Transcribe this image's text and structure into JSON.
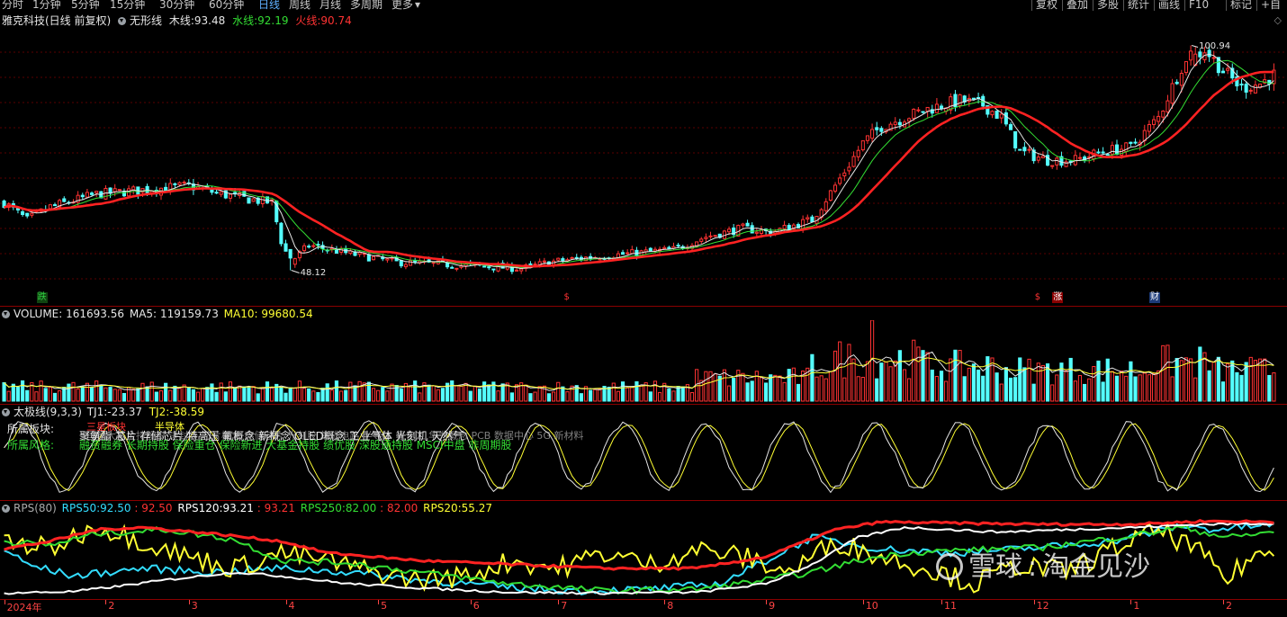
{
  "toolbar": {
    "periods": [
      "分时",
      "1分钟",
      "5分钟",
      "15分钟",
      "30分钟",
      "60分钟",
      "日线",
      "周线",
      "月线",
      "多周期",
      "更多"
    ],
    "active_period": "日线",
    "right_buttons": [
      "复权",
      "叠加",
      "多股",
      "统计",
      "画线",
      "F10",
      "标记",
      "+自"
    ]
  },
  "main_panel": {
    "title": "雅克科技(日线 前复权)",
    "indicator_name": "无形线",
    "mu_label": "木线:",
    "mu_value": "93.48",
    "shui_label": "水线:",
    "shui_value": "92.19",
    "huo_label": "火线:",
    "huo_value": "90.74",
    "high_label": "100.94",
    "low_label": "48.12",
    "markers": [
      {
        "text": "跌",
        "day": 8,
        "color": "#2ecc40",
        "bg": "#114411"
      },
      {
        "text": "$",
        "day": 122,
        "color": "#ff3333",
        "bg": ""
      },
      {
        "text": "$",
        "day": 224,
        "color": "#ff3333",
        "bg": ""
      },
      {
        "text": "涨",
        "day": 228,
        "color": "#ffffff",
        "bg": "#8a0000"
      },
      {
        "text": "财",
        "day": 249,
        "color": "#ffffff",
        "bg": "#1c3a78"
      }
    ]
  },
  "volume_panel": {
    "label": "VOLUME:",
    "value": "161693.56",
    "ma5_label": "MA5:",
    "ma5_value": "119159.73",
    "ma10_label": "MA10:",
    "ma10_value": "99680.54"
  },
  "taiji_panel": {
    "name": "太极线(9,3,3)",
    "tj1_label": "TJ1:",
    "tj1_value": "-23.37",
    "tj2_label": "TJ2:",
    "tj2_value": "-38.59",
    "sector_label": "所属板块:",
    "sector_tag1": "三星板块",
    "sector_tag2": "半导体",
    "concept_text": "国家大基金持股 先进封装 芯片概念 存储芯片 光刻胶 集成电路 半导体 氟化工 华为概念 PCB 数据中心 5G 新材料",
    "overlay_text": "聚氨酯 芯片 存储芯片 特高压 氟概念 新概念 OLED概念 工业气体 光刻机 天然气",
    "style_label": "所属风格:",
    "style_text": "融资融券 长期持股 保险重仓 保险新进 大基金持股 绩优股 深股通持股 MSCI中盘 非周期股"
  },
  "rps_panel": {
    "name": "RPS(80)",
    "rps50_label": "RPS50:",
    "rps50_value": "92.50",
    "rps50b_value": ": 92.50",
    "rps120_label": "RPS120:",
    "rps120_value": "93.21",
    "rps120b_value": ": 93.21",
    "rps250_label": "RPS250:",
    "rps250_value": "82.00",
    "rps250b_value": ": 82.00",
    "rps20_label": "RPS20:",
    "rps20_value": "55.27"
  },
  "x_axis": {
    "labels": [
      {
        "text": "2024年",
        "day": 0
      },
      {
        "text": "2",
        "day": 22
      },
      {
        "text": "3",
        "day": 40
      },
      {
        "text": "4",
        "day": 61
      },
      {
        "text": "5",
        "day": 81
      },
      {
        "text": "6",
        "day": 101
      },
      {
        "text": "7",
        "day": 120
      },
      {
        "text": "8",
        "day": 143
      },
      {
        "text": "9",
        "day": 165
      },
      {
        "text": "10",
        "day": 186
      },
      {
        "text": "11",
        "day": 203
      },
      {
        "text": "12",
        "day": 223
      },
      {
        "text": "1",
        "day": 244
      },
      {
        "text": "2",
        "day": 264
      }
    ]
  },
  "watermark": {
    "brand": "雪球",
    "separator": ":",
    "author": "淘金见沙"
  },
  "chart_data": {
    "type": "candlestick",
    "days": 276,
    "price_range": [
      44,
      104
    ],
    "anchors": [
      [
        0,
        64
      ],
      [
        5,
        60
      ],
      [
        10,
        63
      ],
      [
        20,
        66
      ],
      [
        30,
        67
      ],
      [
        40,
        68
      ],
      [
        47,
        66
      ],
      [
        52,
        65
      ],
      [
        58,
        64
      ],
      [
        60,
        55
      ],
      [
        62,
        50
      ],
      [
        66,
        54
      ],
      [
        75,
        52
      ],
      [
        85,
        50
      ],
      [
        95,
        49.5
      ],
      [
        105,
        49
      ],
      [
        112,
        48.5
      ],
      [
        118,
        50
      ],
      [
        125,
        51
      ],
      [
        135,
        52
      ],
      [
        145,
        53
      ],
      [
        152,
        56
      ],
      [
        160,
        58
      ],
      [
        166,
        57
      ],
      [
        175,
        60
      ],
      [
        180,
        68
      ],
      [
        186,
        78
      ],
      [
        190,
        82
      ],
      [
        195,
        84
      ],
      [
        200,
        86
      ],
      [
        207,
        88
      ],
      [
        212,
        87
      ],
      [
        216,
        84
      ],
      [
        220,
        76
      ],
      [
        226,
        74
      ],
      [
        232,
        74
      ],
      [
        238,
        76
      ],
      [
        244,
        77
      ],
      [
        250,
        84
      ],
      [
        255,
        96
      ],
      [
        260,
        100
      ],
      [
        264,
        95
      ],
      [
        268,
        91
      ],
      [
        272,
        92
      ],
      [
        275,
        94
      ]
    ]
  }
}
